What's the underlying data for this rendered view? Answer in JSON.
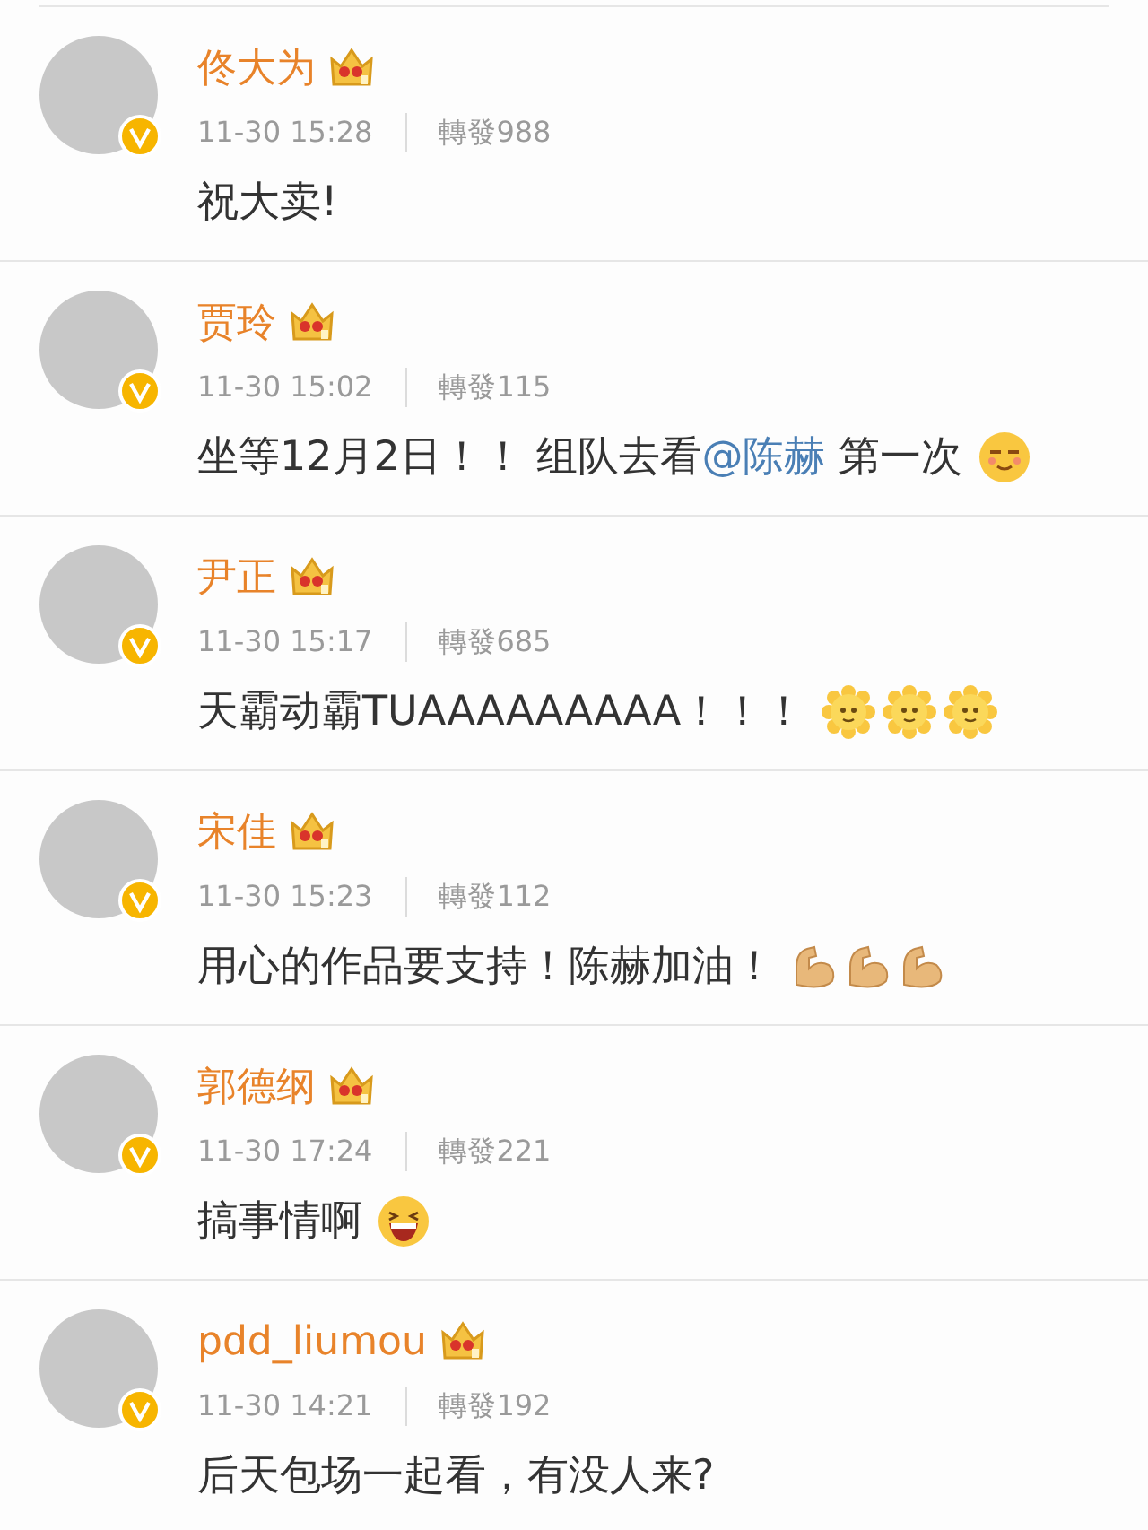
{
  "comments": [
    {
      "name": "佟大为",
      "time": "11-30 15:28",
      "reposts": "轉發988",
      "content": [
        {
          "kind": "text",
          "text": "祝大卖!"
        }
      ]
    },
    {
      "name": "贾玲",
      "time": "11-30 15:02",
      "reposts": "轉發115",
      "content": [
        {
          "kind": "text",
          "text": "坐等12月2日！！ 组队去看"
        },
        {
          "kind": "mention",
          "text": "@陈赫"
        },
        {
          "kind": "text",
          "text": " 第一次"
        }
      ],
      "emojis": [
        {
          "kind": "smug"
        }
      ]
    },
    {
      "name": "尹正",
      "time": "11-30 15:17",
      "reposts": "轉發685",
      "content": [
        {
          "kind": "text",
          "text": "天霸动霸TUAAAAAAAAA！！！"
        }
      ],
      "emojis": [
        {
          "kind": "sun"
        },
        {
          "kind": "sun"
        },
        {
          "kind": "sun"
        }
      ]
    },
    {
      "name": "宋佳",
      "time": "11-30 15:23",
      "reposts": "轉發112",
      "content": [
        {
          "kind": "text",
          "text": "用心的作品要支持！陈赫加油！"
        }
      ],
      "emojis": [
        {
          "kind": "muscle"
        },
        {
          "kind": "muscle"
        },
        {
          "kind": "muscle"
        }
      ]
    },
    {
      "name": "郭德纲",
      "time": "11-30 17:24",
      "reposts": "轉發221",
      "content": [
        {
          "kind": "text",
          "text": "搞事情啊"
        }
      ],
      "emojis": [
        {
          "kind": "laugh"
        }
      ]
    },
    {
      "name": "pdd_liumou",
      "time": "11-30 14:21",
      "reposts": "轉發192",
      "content": [
        {
          "kind": "text",
          "text": "后天包场一起看，有没人来?"
        }
      ]
    }
  ]
}
